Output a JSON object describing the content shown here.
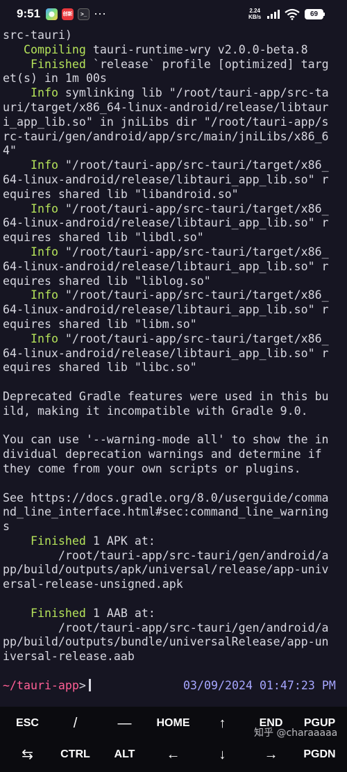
{
  "status_bar": {
    "time": "9:51",
    "app_badge_2": "创新",
    "app_badge_3": ">_",
    "dots": "···",
    "speed_value": "2.24",
    "speed_unit": "KB/s",
    "battery": "69",
    "icons": [
      "photos-app-icon",
      "red-app-icon",
      "terminal-app-icon",
      "signal-icon",
      "wifi-icon",
      "battery-icon"
    ]
  },
  "terminal": {
    "lines": [
      {
        "pre": "src-tauri)",
        "kw": "",
        "post": ""
      },
      {
        "pre": "   ",
        "kw": "Compiling",
        "post": " tauri-runtime-wry v2.0.0-beta.8"
      },
      {
        "pre": "    ",
        "kw": "Finished",
        "post": " `release` profile [optimized] targ"
      },
      {
        "pre": "et(s) in 1m 00s",
        "kw": "",
        "post": ""
      },
      {
        "pre": "    ",
        "kw": "Info",
        "post": " symlinking lib \"/root/tauri-app/src-ta"
      },
      {
        "pre": "uri/target/x86_64-linux-android/release/libtaur",
        "kw": "",
        "post": ""
      },
      {
        "pre": "i_app_lib.so\" in jniLibs dir \"/root/tauri-app/s",
        "kw": "",
        "post": ""
      },
      {
        "pre": "rc-tauri/gen/android/app/src/main/jniLibs/x86_6",
        "kw": "",
        "post": ""
      },
      {
        "pre": "4\"",
        "kw": "",
        "post": ""
      },
      {
        "pre": "    ",
        "kw": "Info",
        "post": " \"/root/tauri-app/src-tauri/target/x86_"
      },
      {
        "pre": "64-linux-android/release/libtauri_app_lib.so\" r",
        "kw": "",
        "post": ""
      },
      {
        "pre": "equires shared lib \"libandroid.so\"",
        "kw": "",
        "post": ""
      },
      {
        "pre": "    ",
        "kw": "Info",
        "post": " \"/root/tauri-app/src-tauri/target/x86_"
      },
      {
        "pre": "64-linux-android/release/libtauri_app_lib.so\" r",
        "kw": "",
        "post": ""
      },
      {
        "pre": "equires shared lib \"libdl.so\"",
        "kw": "",
        "post": ""
      },
      {
        "pre": "    ",
        "kw": "Info",
        "post": " \"/root/tauri-app/src-tauri/target/x86_"
      },
      {
        "pre": "64-linux-android/release/libtauri_app_lib.so\" r",
        "kw": "",
        "post": ""
      },
      {
        "pre": "equires shared lib \"liblog.so\"",
        "kw": "",
        "post": ""
      },
      {
        "pre": "    ",
        "kw": "Info",
        "post": " \"/root/tauri-app/src-tauri/target/x86_"
      },
      {
        "pre": "64-linux-android/release/libtauri_app_lib.so\" r",
        "kw": "",
        "post": ""
      },
      {
        "pre": "equires shared lib \"libm.so\"",
        "kw": "",
        "post": ""
      },
      {
        "pre": "    ",
        "kw": "Info",
        "post": " \"/root/tauri-app/src-tauri/target/x86_"
      },
      {
        "pre": "64-linux-android/release/libtauri_app_lib.so\" r",
        "kw": "",
        "post": ""
      },
      {
        "pre": "equires shared lib \"libc.so\"",
        "kw": "",
        "post": ""
      },
      {
        "pre": "",
        "kw": "",
        "post": ""
      },
      {
        "pre": "Deprecated Gradle features were used in this bu",
        "kw": "",
        "post": ""
      },
      {
        "pre": "ild, making it incompatible with Gradle 9.0.",
        "kw": "",
        "post": ""
      },
      {
        "pre": "",
        "kw": "",
        "post": ""
      },
      {
        "pre": "You can use '--warning-mode all' to show the in",
        "kw": "",
        "post": ""
      },
      {
        "pre": "dividual deprecation warnings and determine if",
        "kw": "",
        "post": ""
      },
      {
        "pre": "they come from your own scripts or plugins.",
        "kw": "",
        "post": ""
      },
      {
        "pre": "",
        "kw": "",
        "post": ""
      },
      {
        "pre": "See https://docs.gradle.org/8.0/userguide/comma",
        "kw": "",
        "post": ""
      },
      {
        "pre": "nd_line_interface.html#sec:command_line_warning",
        "kw": "",
        "post": ""
      },
      {
        "pre": "s",
        "kw": "",
        "post": ""
      },
      {
        "pre": "    ",
        "kw": "Finished",
        "post": " 1 APK at:"
      },
      {
        "pre": "        /root/tauri-app/src-tauri/gen/android/a",
        "kw": "",
        "post": ""
      },
      {
        "pre": "pp/build/outputs/apk/universal/release/app-univ",
        "kw": "",
        "post": ""
      },
      {
        "pre": "ersal-release-unsigned.apk",
        "kw": "",
        "post": ""
      },
      {
        "pre": "",
        "kw": "",
        "post": ""
      },
      {
        "pre": "    ",
        "kw": "Finished",
        "post": " 1 AAB at:"
      },
      {
        "pre": "        /root/tauri-app/src-tauri/gen/android/a",
        "kw": "",
        "post": ""
      },
      {
        "pre": "pp/build/outputs/bundle/universalRelease/app-un",
        "kw": "",
        "post": ""
      },
      {
        "pre": "iversal-release.aab",
        "kw": "",
        "post": ""
      },
      {
        "pre": "",
        "kw": "",
        "post": ""
      }
    ],
    "prompt": {
      "path": "~/tauri-app",
      "arrow": ">",
      "date_mm": "03",
      "date_dd": "09",
      "date_yyyy": "2024",
      "time_hh": "01",
      "time_mm": "47",
      "time_ss": "23",
      "ampm": "PM",
      "date_sep": "/",
      "time_sep": ":"
    }
  },
  "extra_keys": {
    "row1": [
      "ESC",
      "/",
      "—",
      "HOME",
      "↑",
      "END",
      "PGUP"
    ],
    "row2": [
      "⇆",
      "CTRL",
      "ALT",
      "←",
      "↓",
      "→",
      "PGDN"
    ]
  },
  "watermark": "知乎 @charaaaaa"
}
